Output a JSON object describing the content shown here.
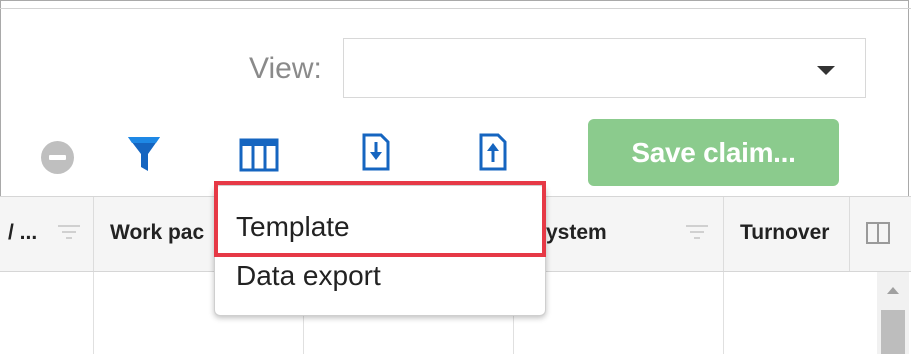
{
  "view": {
    "label": "View:",
    "selected": ""
  },
  "toolbar": {
    "icons": [
      "minus-circle-icon",
      "filter-icon",
      "columns-icon",
      "import-icon",
      "export-icon"
    ],
    "save_label": "Save claim..."
  },
  "grid": {
    "columns": [
      {
        "label": "/ ..."
      },
      {
        "label": "Work pac"
      },
      {
        "label": "ystem"
      },
      {
        "label": "Turnover"
      }
    ]
  },
  "dropdown": {
    "items": [
      {
        "label": "Template",
        "highlighted": true
      },
      {
        "label": "Data export",
        "highlighted": false
      }
    ]
  },
  "colors": {
    "filter_blue": "#1565c0",
    "save_green": "#8bcb8d",
    "highlight_red": "#e63946"
  }
}
